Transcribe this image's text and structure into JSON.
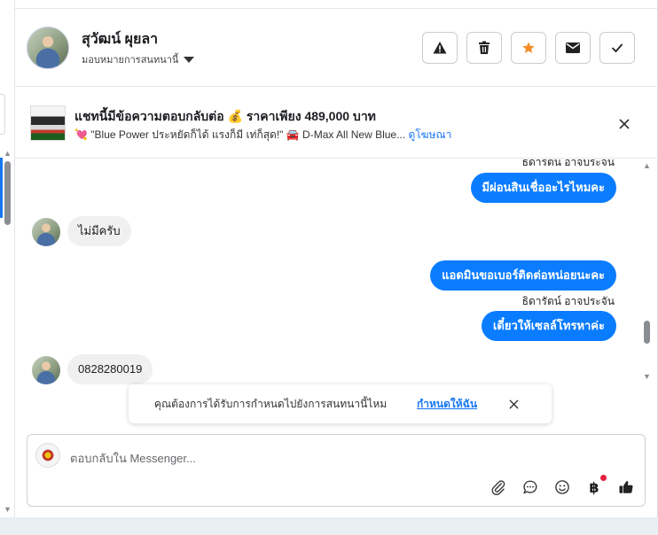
{
  "contact": {
    "name": "สุวัฒน์ ผุยลา",
    "assign_label": "มอบหมายการสนทนานี้"
  },
  "header_actions": [
    {
      "icon": "warning-icon"
    },
    {
      "icon": "trash-icon"
    },
    {
      "icon": "star-icon",
      "color": "#f28c28"
    },
    {
      "icon": "mail-icon"
    },
    {
      "icon": "check-icon"
    }
  ],
  "ad_banner": {
    "title": "แชทนี้มีข้อความตอบกลับต่อ 💰 ราคาเพียง 489,000 บาท",
    "subtitle_prefix": "💘 \"Blue Power ประหยัดก็ได้ แรงก็มี เท่ก็สุด!\"  🚘 D-Max All New Blue...",
    "link": "ดูโฆษณา"
  },
  "messages": [
    {
      "direction": "out",
      "sender": "ธิดารัตน์ อาจประจัน",
      "text": "มีผ่อนสินเชื่ออะไรไหมคะ"
    },
    {
      "direction": "in",
      "text": "ไม่มีครับ"
    },
    {
      "direction": "out",
      "text": "แอดมินขอเบอร์ติดต่อหน่อยนะคะ"
    },
    {
      "direction": "out",
      "sender": "ธิดารัตน์ อาจประจัน",
      "text": "เดี๋ยวให้เซลล์โทรหาค่ะ"
    },
    {
      "direction": "in",
      "text": "0828280019"
    }
  ],
  "toast": {
    "text": "คุณต้องการได้รับการกำหนดไปยังการสนทนานี้ไหม",
    "link": "กำหนดให้ฉัน"
  },
  "composer": {
    "placeholder": "ตอบกลับใน Messenger...",
    "tools": [
      "attach-icon",
      "chat-bubble-icon",
      "emoji-icon",
      "baht-icon",
      "thumbs-up-icon"
    ],
    "baht_symbol": "฿"
  },
  "colors": {
    "outgoing_bubble": "#0a7cff",
    "incoming_bubble": "#f0f0f0",
    "link": "#1877f2",
    "star": "#f28c28"
  }
}
